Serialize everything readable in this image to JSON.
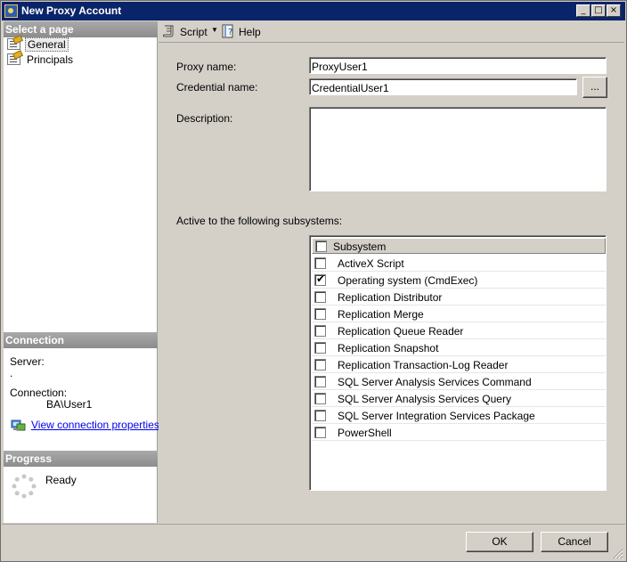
{
  "window": {
    "title": "New Proxy Account",
    "controls": [
      "_",
      "□",
      "×"
    ]
  },
  "left_panel": {
    "select_header": "Select a page",
    "pages": [
      {
        "label": "General",
        "icon": "page-icon",
        "selected": true
      },
      {
        "label": "Principals",
        "icon": "page-icon",
        "selected": false
      }
    ],
    "connection": {
      "header": "Connection",
      "server_label": "Server:",
      "server_value": ".",
      "connection_label": "Connection:",
      "connection_value": "BA\\User1",
      "link_text": "View connection properties"
    },
    "progress": {
      "header": "Progress",
      "status": "Ready"
    }
  },
  "toolbar": {
    "script_label": "Script",
    "help_label": "Help"
  },
  "form": {
    "proxy_name_label": "Proxy name:",
    "proxy_name_value": "ProxyUser1",
    "credential_name_label": "Credential name:",
    "credential_name_value": "CredentialUser1",
    "browse_label": "...",
    "description_label": "Description:",
    "description_value": "",
    "subsystems_label": "Active to the following subsystems:"
  },
  "subsystems": {
    "column_header": "Subsystem",
    "header_checked": false,
    "rows": [
      {
        "label": "ActiveX Script",
        "checked": false
      },
      {
        "label": "Operating system (CmdExec)",
        "checked": true
      },
      {
        "label": "Replication Distributor",
        "checked": false
      },
      {
        "label": "Replication Merge",
        "checked": false
      },
      {
        "label": "Replication Queue Reader",
        "checked": false
      },
      {
        "label": "Replication Snapshot",
        "checked": false
      },
      {
        "label": "Replication Transaction-Log Reader",
        "checked": false
      },
      {
        "label": "SQL Server Analysis Services Command",
        "checked": false
      },
      {
        "label": "SQL Server Analysis Services Query",
        "checked": false
      },
      {
        "label": "SQL Server Integration Services Package",
        "checked": false
      },
      {
        "label": "PowerShell",
        "checked": false
      }
    ]
  },
  "footer": {
    "ok_label": "OK",
    "cancel_label": "Cancel"
  }
}
